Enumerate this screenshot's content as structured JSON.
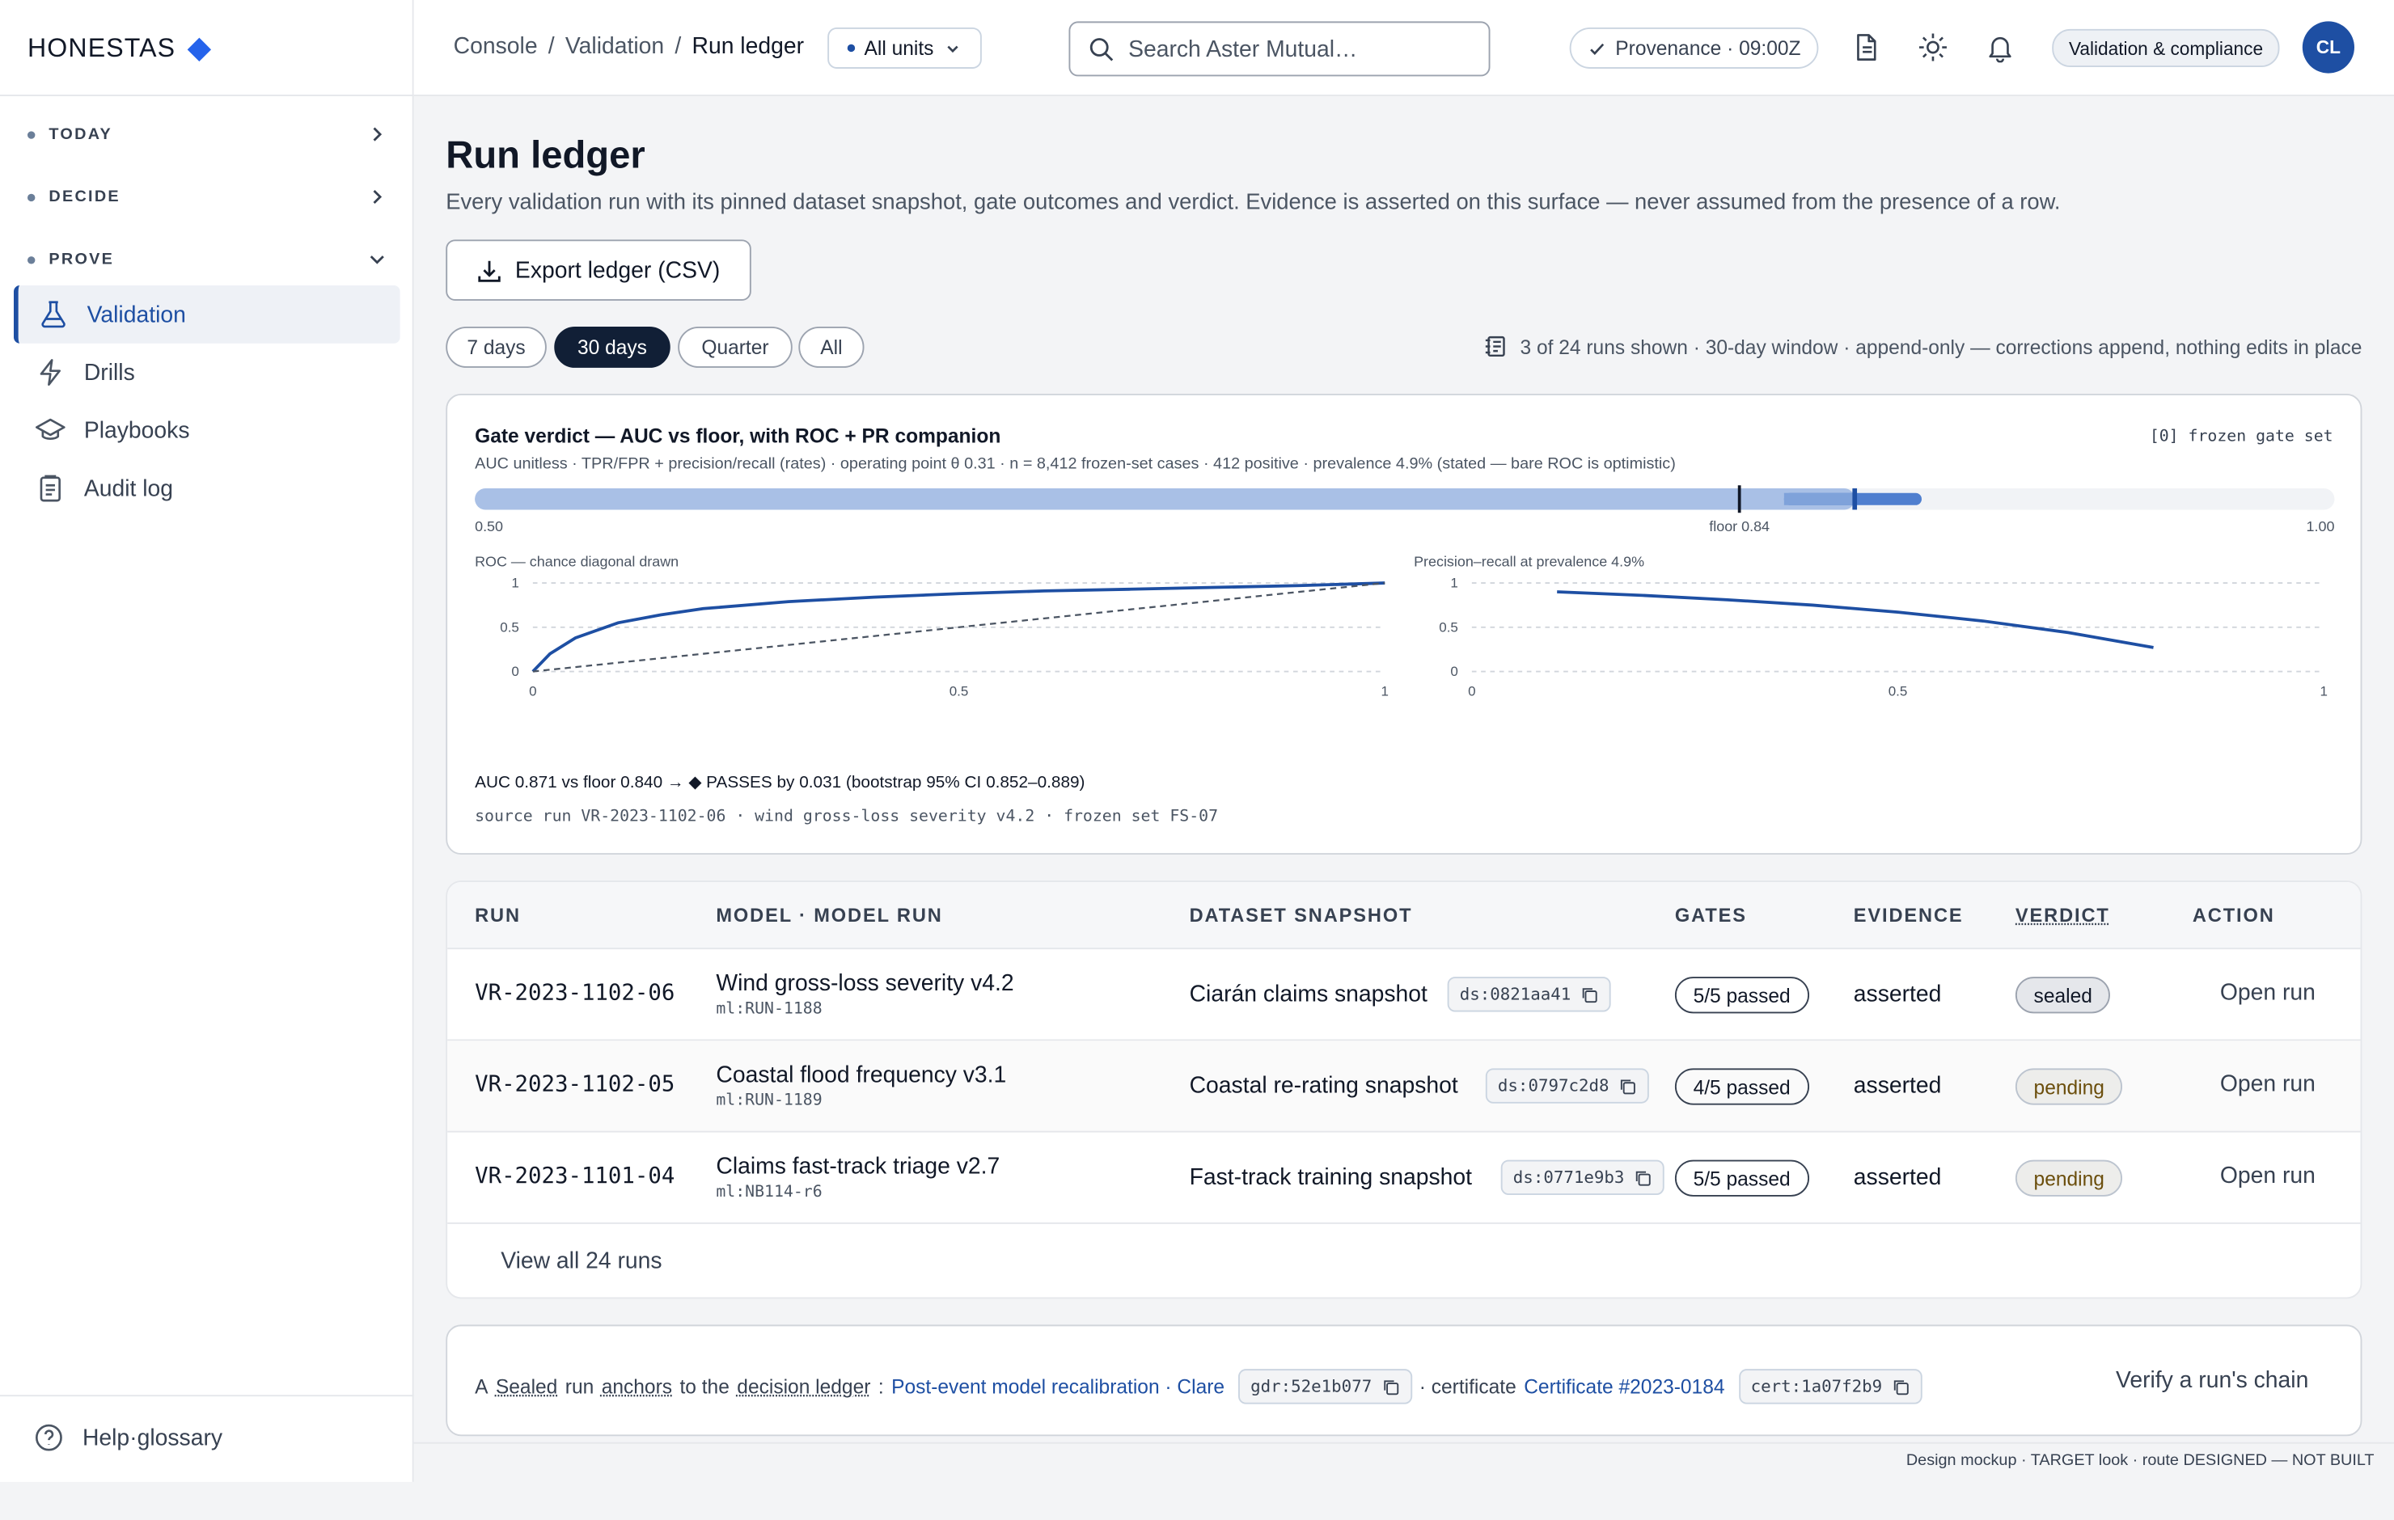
{
  "brand": {
    "name": "HONESTAS",
    "accent": "#2563eb",
    "nav_accent": "#1e4fa3"
  },
  "sidebar": {
    "sections": [
      {
        "label": "TODAY",
        "state": "collapsed"
      },
      {
        "label": "DECIDE",
        "state": "collapsed"
      },
      {
        "label": "PROVE",
        "state": "expanded"
      }
    ],
    "items": [
      {
        "label": "Validation",
        "icon": "flask-icon",
        "active": true
      },
      {
        "label": "Drills",
        "icon": "bolt-icon"
      },
      {
        "label": "Playbooks",
        "icon": "graduation-cap-icon"
      },
      {
        "label": "Audit log",
        "icon": "clipboard-icon"
      }
    ],
    "help_label": "Help·glossary"
  },
  "header": {
    "breadcrumb": [
      "Console",
      "Validation",
      "Run ledger"
    ],
    "units_label": "All units",
    "search_placeholder": "Search Aster Mutual…",
    "provenance": "Provenance · 09:00Z",
    "role_chip": "Validation & compliance",
    "avatar": "CL"
  },
  "page": {
    "title": "Run ledger",
    "subtitle": "Every validation run with its pinned dataset snapshot, gate outcomes and verdict. Evidence is asserted on this surface — never assumed from the presence of a row.",
    "export_label": "Export ledger (CSV)",
    "ranges": [
      "7 days",
      "30 days",
      "Quarter",
      "All"
    ],
    "active_range": "30 days",
    "window_note": "3 of 24 runs shown · 30-day window · append-only — corrections append, nothing edits in place"
  },
  "gate_card": {
    "title": "Gate verdict — AUC vs floor, with ROC + PR companion",
    "frozen": "[0] frozen gate set",
    "subtitle": "AUC unitless · TPR/FPR + precision/recall (rates) · operating point θ 0.31 · n = 8,412 frozen-set cases · 412 positive · prevalence 4.9% (stated — bare ROC is optimistic)",
    "verdict_line": "AUC 0.871 vs floor 0.840 → ◆ PASSES by 0.031 (bootstrap 95% CI 0.852–0.889)",
    "source": "source run VR-2023-1102-06 · wind gross-loss severity v4.2 · frozen set FS-07"
  },
  "chart_data": [
    {
      "type": "bar",
      "title": "AUC vs floor",
      "x_min_label": "0.50",
      "floor_label": "floor 0.84",
      "x_max_label": "1.00",
      "xlim": [
        0.5,
        1.0
      ],
      "auc": 0.871,
      "floor": 0.84,
      "ci": [
        0.852,
        0.889
      ]
    },
    {
      "type": "line",
      "title": "ROC — chance diagonal drawn",
      "xlim": [
        0,
        1
      ],
      "ylim": [
        0,
        1
      ],
      "x_ticks": [
        "0",
        "0.5",
        "1"
      ],
      "y_ticks": [
        "0",
        "0.5",
        "1"
      ],
      "series": [
        {
          "x": [
            0,
            0.02,
            0.05,
            0.1,
            0.15,
            0.2,
            0.3,
            0.4,
            0.5,
            0.6,
            0.7,
            0.8,
            0.9,
            1.0
          ],
          "y": [
            0,
            0.2,
            0.38,
            0.55,
            0.64,
            0.71,
            0.79,
            0.84,
            0.88,
            0.91,
            0.93,
            0.95,
            0.97,
            1.0
          ]
        },
        {
          "x": [
            0,
            1
          ],
          "y": [
            0,
            1
          ],
          "dashed": true
        }
      ]
    },
    {
      "type": "line",
      "title": "Precision–recall at prevalence 4.9%",
      "xlim": [
        0,
        1
      ],
      "ylim": [
        0,
        1
      ],
      "x_ticks": [
        "0",
        "0.5",
        "1"
      ],
      "y_ticks": [
        "0",
        "0.5",
        "1"
      ],
      "series": [
        {
          "x": [
            0.1,
            0.2,
            0.3,
            0.4,
            0.5,
            0.6,
            0.7,
            0.8
          ],
          "y": [
            0.9,
            0.86,
            0.81,
            0.75,
            0.67,
            0.57,
            0.44,
            0.27
          ]
        }
      ]
    }
  ],
  "table": {
    "headers": [
      "RUN",
      "MODEL · MODEL RUN",
      "DATASET SNAPSHOT",
      "GATES",
      "EVIDENCE",
      "VERDICT",
      "ACTION"
    ],
    "rows": [
      {
        "run": "VR-2023-1102-06",
        "model": "Wind gross-loss severity v4.2",
        "model_run": "ml:RUN-1188",
        "snapshot": "Ciarán claims snapshot",
        "ds": "ds:0821aa41",
        "gates": "5/5 passed",
        "evidence": "asserted",
        "verdict": "sealed",
        "action": "Open run"
      },
      {
        "run": "VR-2023-1102-05",
        "model": "Coastal flood frequency v3.1",
        "model_run": "ml:RUN-1189",
        "snapshot": "Coastal re-rating snapshot",
        "ds": "ds:0797c2d8",
        "gates": "4/5 passed",
        "evidence": "asserted",
        "verdict": "pending",
        "action": "Open run"
      },
      {
        "run": "VR-2023-1101-04",
        "model": "Claims fast-track triage v2.7",
        "model_run": "ml:NB114-r6",
        "snapshot": "Fast-track training snapshot",
        "ds": "ds:0771e9b3",
        "gates": "5/5 passed",
        "evidence": "asserted",
        "verdict": "pending",
        "action": "Open run"
      }
    ],
    "view_all": "View all 24 runs"
  },
  "anchor": {
    "p1": "A",
    "w_sealed": "Sealed",
    "p2": "run",
    "w_anchors": "anchors",
    "p3": "to the",
    "w_ledger": "decision ledger",
    "link1": "Post-event model recalibration · Clare",
    "chip1": "gdr:52e1b077",
    "p4": "· certificate",
    "link2": "Certificate #2023-0184",
    "chip2": "cert:1a07f2b9",
    "verify": "Verify a run's chain"
  },
  "footer": "Design mockup · TARGET look · route DESIGNED — NOT BUILT"
}
